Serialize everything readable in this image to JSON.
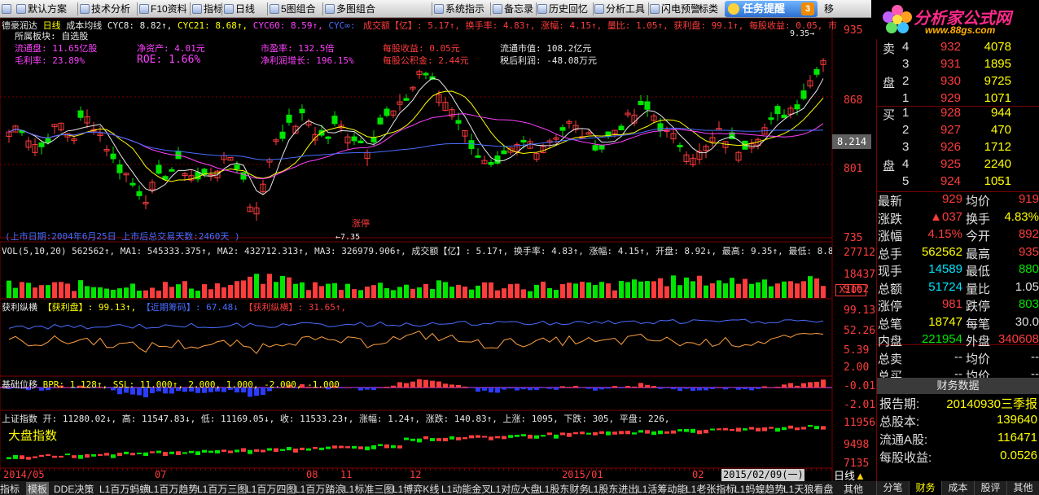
{
  "toolbar": {
    "items": [
      "默认方案",
      "技术分析",
      "F10资料",
      "指标",
      "日线",
      "5图组合",
      "多图组合",
      "系统指示",
      "备忘录",
      "历史回忆",
      "分析工具",
      "闪电预警",
      "标类"
    ],
    "task_label": "任务提醒",
    "task_count": "3",
    "tail": "移"
  },
  "brand": {
    "name": "分析家公式网",
    "site": "www.88gs.com"
  },
  "main": {
    "stock_name": "德豪润达",
    "period": "日线",
    "ma_title": "成本均线",
    "cyc8": "CYC8: 8.82↑,",
    "cyc21": "CYC21: 8.68↑,",
    "cyc60": "CYC60: 8.59↑,",
    "cycx": "CYC∞:",
    "mline": "成交额【亿】: 5.17↑, 换手率: 4.83↑, 涨幅: 4.15↑, 量比: 1.05↑, 获利盘: 99.1↑, 每股收益: 0.05, 市",
    "sector": "所属板块: 自选股",
    "f1": "流通盘: 11.65亿股",
    "f2": "净资产: 4.01元",
    "f3": "市盈率: 132.5倍",
    "f4": "每股收益: 0.05元",
    "f5": "流通市值: 108.2亿元",
    "f6": "毛利率: 23.89%",
    "f7": "ROE: 1.66%",
    "f8": "净利润增长: 196.15%",
    "f9": "每股公积金: 2.44元",
    "f10": "税后利润: -48.08万元",
    "listing": "(上市日期:2004年6月25日 上市后总交易天数:2460天 )",
    "low_mark": "←7.35",
    "limit_mark": "涨停",
    "high_mark": "9.35→"
  },
  "axis": {
    "p1": "935",
    "p2": "868",
    "p3": "801",
    "p4": "735",
    "price_tag": "8.214",
    "v1": "27712",
    "v2": "18437",
    "v3": "9162",
    "vunit": "X100",
    "h1": "99.13",
    "h2": "52.26",
    "h3": "5.39",
    "b1": "2.00",
    "b2": "-0.01",
    "b3": "-2.01",
    "i1": "11956",
    "i2": "9498",
    "i3": "7135"
  },
  "vol": {
    "text": "VOL(5,10,20) 562562↑, MA1: 545333.375↑, MA2: 432712.313↑, MA3: 326979.906↑, 成交额【亿】: 5.17↑, 换手率: 4.83↑, 涨幅: 4.15↑, 开盘: 8.92↓, 最高: 9.35↑, 最低: 8.80↓, 收盘: 9."
  },
  "profit": {
    "name": "获利纵横",
    "a": "【获利盘】: 99.13↑,",
    "b": "【近期筹码】: 67.48↓",
    "c": "【获利纵横】: 31.65↑,"
  },
  "base": {
    "name": "基础位移",
    "text": "BPR: 1.128↑, SSL: 11.000↑, 2.000, 1.000, -2.000, -1.000"
  },
  "index": {
    "name": "上证指数",
    "text": "开: 11280.02↓, 高: 11547.83↓, 低: 11169.05↓, 收: 11533.23↑, 涨幅: 1.24↑, 涨跌: 140.83↑, 上涨: 1095, 下跌: 305, 平盘: 226,",
    "big": "大盘指数"
  },
  "dates": [
    "2014/05",
    "07",
    "08",
    "11",
    "12",
    "2015/01",
    "02",
    "2015/02/09(一)"
  ],
  "period_btn": "日线",
  "orderbook": {
    "sell": [
      {
        "label": "卖",
        "n": "4",
        "p": "932",
        "v": "4078"
      },
      {
        "n": "3",
        "p": "931",
        "v": "1895"
      },
      {
        "label": "盘",
        "n": "2",
        "p": "930",
        "v": "9725"
      },
      {
        "n": "1",
        "p": "929",
        "v": "1071"
      }
    ],
    "buy": [
      {
        "label": "买",
        "n": "1",
        "p": "928",
        "v": "944"
      },
      {
        "n": "2",
        "p": "927",
        "v": "470"
      },
      {
        "label": "",
        "n": "3",
        "p": "926",
        "v": "1712"
      },
      {
        "label": "盘",
        "n": "4",
        "p": "925",
        "v": "2240"
      },
      {
        "n": "5",
        "p": "924",
        "v": "1051"
      }
    ]
  },
  "quote": [
    {
      "k": "最新",
      "v": "929",
      "k2": "均价",
      "v2": "919"
    },
    {
      "k": "涨跌",
      "v": "▲037",
      "k2": "换手",
      "v2": "4.83%"
    },
    {
      "k": "涨幅",
      "v": "4.15%",
      "k2": "今开",
      "v2": "892"
    },
    {
      "k": "总手",
      "v": "562562",
      "k2": "最高",
      "v2": "935"
    },
    {
      "k": "现手",
      "v": "14589",
      "k2": "最低",
      "v2": "880"
    },
    {
      "k": "总额",
      "v": "51724",
      "k2": "量比",
      "v2": "1.05"
    },
    {
      "k": "涨停",
      "v": "981",
      "k2": "跌停",
      "v2": "803"
    },
    {
      "k": "总笔",
      "v": "18747",
      "k2": "每笔",
      "v2": "30.0"
    },
    {
      "k": "内盘",
      "v": "221954",
      "k2": "外盘",
      "v2": "340608"
    },
    {
      "k": "总卖",
      "v": "--",
      "k2": "均价",
      "v2": "--"
    },
    {
      "k": "总买",
      "v": "--",
      "k2": "均价",
      "v2": "--"
    }
  ],
  "finance": {
    "title": "财务数据",
    "rows": [
      {
        "k": "报告期:",
        "v": "20140930三季报"
      },
      {
        "k": "总股本:",
        "v": "139640"
      },
      {
        "k": "流通A股:",
        "v": "116471"
      },
      {
        "k": "每股收益:",
        "v": "0.0526"
      }
    ]
  },
  "bottom_tabs": [
    "指标",
    "模板",
    "DDE决策",
    "L1百万蚂蟥",
    "L1百万趋势",
    "L1百万三图",
    "L1百万四图",
    "L1百万踏浪",
    "L1标准三图",
    "L1博弈K线",
    "L1动能金叉",
    "L1对应大盘",
    "L1股东财务",
    "L1股东进出",
    "L1活筹动能",
    "L1老张指标",
    "L1蚂蝗趋势",
    "L1天狼看盘",
    "其他"
  ],
  "right_tabs": [
    "分笔",
    "财务",
    "成本",
    "股评",
    "其他"
  ],
  "colors": {
    "up": "#ff3c3c",
    "down": "#00e600",
    "accent": "#ffff00",
    "panel_border": "#7a0000"
  }
}
